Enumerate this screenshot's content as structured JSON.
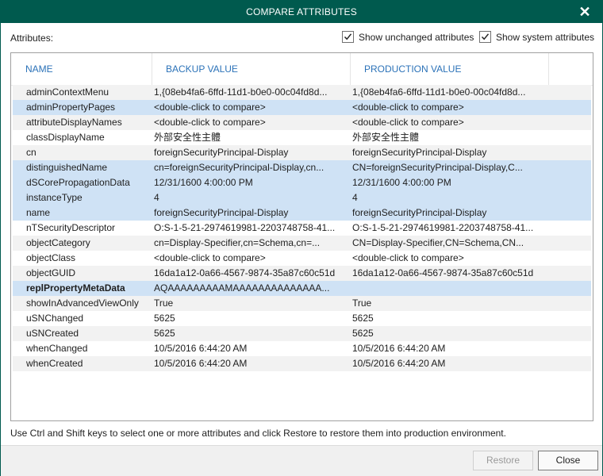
{
  "window": {
    "title": "COMPARE ATTRIBUTES",
    "close_glyph": "✕"
  },
  "attributes_label": "Attributes:",
  "options": {
    "show_unchanged": {
      "label": "Show unchanged attributes",
      "checked": true
    },
    "show_system": {
      "label": "Show system attributes",
      "checked": true
    }
  },
  "table": {
    "columns": [
      "NAME",
      "BACKUP VALUE",
      "PRODUCTION VALUE"
    ],
    "rows": [
      {
        "name": "adminContextMenu",
        "backup": "1,{08eb4fa6-6ffd-11d1-b0e0-00c04fd8d...",
        "production": "1,{08eb4fa6-6ffd-11d1-b0e0-00c04fd8d...",
        "selected": false
      },
      {
        "name": "adminPropertyPages",
        "backup": "<double-click to compare>",
        "production": "<double-click to compare>",
        "selected": true
      },
      {
        "name": "attributeDisplayNames",
        "backup": "<double-click to compare>",
        "production": "<double-click to compare>",
        "selected": false
      },
      {
        "name": "classDisplayName",
        "backup": "外部安全性主體",
        "production": "外部安全性主體",
        "selected": false
      },
      {
        "name": "cn",
        "backup": "foreignSecurityPrincipal-Display",
        "production": "foreignSecurityPrincipal-Display",
        "selected": false
      },
      {
        "name": "distinguishedName",
        "backup": "cn=foreignSecurityPrincipal-Display,cn...",
        "production": "CN=foreignSecurityPrincipal-Display,C...",
        "selected": true
      },
      {
        "name": "dSCorePropagationData",
        "backup": "12/31/1600 4:00:00 PM",
        "production": "12/31/1600 4:00:00 PM",
        "selected": true
      },
      {
        "name": "instanceType",
        "backup": "4",
        "production": "4",
        "selected": true
      },
      {
        "name": "name",
        "backup": "foreignSecurityPrincipal-Display",
        "production": "foreignSecurityPrincipal-Display",
        "selected": true
      },
      {
        "name": "nTSecurityDescriptor",
        "backup": "O:S-1-5-21-2974619981-2203748758-41...",
        "production": "O:S-1-5-21-2974619981-2203748758-41...",
        "selected": false
      },
      {
        "name": "objectCategory",
        "backup": "cn=Display-Specifier,cn=Schema,cn=...",
        "production": "CN=Display-Specifier,CN=Schema,CN...",
        "selected": false
      },
      {
        "name": "objectClass",
        "backup": "<double-click to compare>",
        "production": "<double-click to compare>",
        "selected": false
      },
      {
        "name": "objectGUID",
        "backup": "16da1a12-0a66-4567-9874-35a87c60c51d",
        "production": "16da1a12-0a66-4567-9874-35a87c60c51d",
        "selected": false
      },
      {
        "name": "replPropertyMetaData",
        "backup": "AQAAAAAAAAAMAAAAAAAAAAAAAA...",
        "production": "",
        "selected": true,
        "focused": true
      },
      {
        "name": "showInAdvancedViewOnly",
        "backup": "True",
        "production": "True",
        "selected": false
      },
      {
        "name": "uSNChanged",
        "backup": "5625",
        "production": "5625",
        "selected": false
      },
      {
        "name": "uSNCreated",
        "backup": "5625",
        "production": "5625",
        "selected": false
      },
      {
        "name": "whenChanged",
        "backup": "10/5/2016 6:44:20 AM",
        "production": "10/5/2016 6:44:20 AM",
        "selected": false
      },
      {
        "name": "whenCreated",
        "backup": "10/5/2016 6:44:20 AM",
        "production": "10/5/2016 6:44:20 AM",
        "selected": false
      }
    ]
  },
  "hint": "Use Ctrl and Shift keys to select one or more attributes and click Restore to restore them into production environment.",
  "buttons": {
    "restore": "Restore",
    "close": "Close"
  },
  "colors": {
    "titlebar": "#005a4e",
    "header_text": "#2b72b8",
    "selected_row": "#cfe2f5",
    "alt_row": "#f2f2f2"
  }
}
